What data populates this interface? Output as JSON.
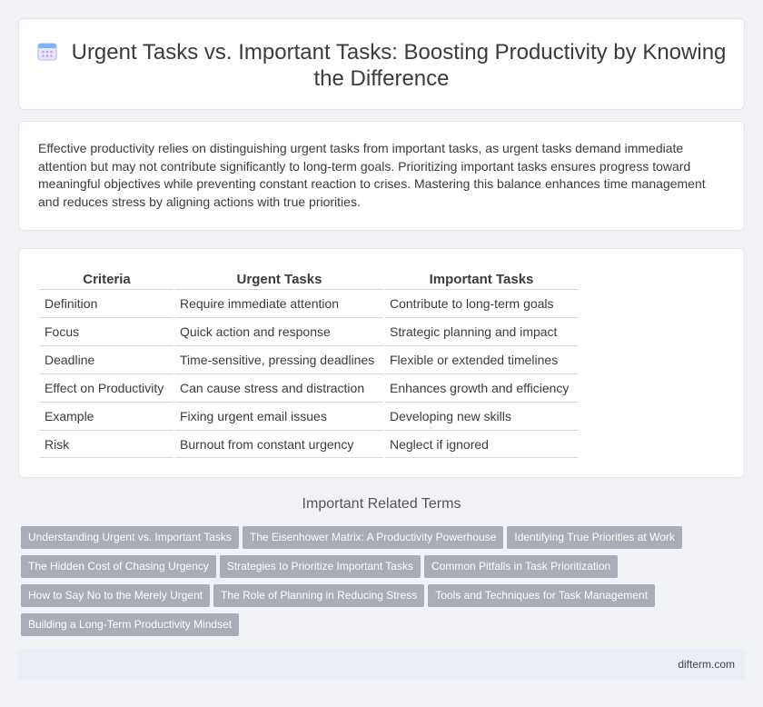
{
  "header": {
    "icon": "calendar-icon",
    "title": "Urgent Tasks vs. Important Tasks: Boosting Productivity by Knowing the Difference"
  },
  "intro": {
    "text": "Effective productivity relies on distinguishing urgent tasks from important tasks, as urgent tasks demand immediate attention but may not contribute significantly to long-term goals. Prioritizing important tasks ensures progress toward meaningful objectives while preventing constant reaction to crises. Mastering this balance enhances time management and reduces stress by aligning actions with true priorities."
  },
  "table": {
    "headers": [
      "Criteria",
      "Urgent Tasks",
      "Important Tasks"
    ],
    "rows": [
      [
        "Definition",
        "Require immediate attention",
        "Contribute to long-term goals"
      ],
      [
        "Focus",
        "Quick action and response",
        "Strategic planning and impact"
      ],
      [
        "Deadline",
        "Time-sensitive, pressing deadlines",
        "Flexible or extended timelines"
      ],
      [
        "Effect on Productivity",
        "Can cause stress and distraction",
        "Enhances growth and efficiency"
      ],
      [
        "Example",
        "Fixing urgent email issues",
        "Developing new skills"
      ],
      [
        "Risk",
        "Burnout from constant urgency",
        "Neglect if ignored"
      ]
    ]
  },
  "related": {
    "title": "Important Related Terms",
    "tags": [
      "Understanding Urgent vs. Important Tasks",
      "The Eisenhower Matrix: A Productivity Powerhouse",
      "Identifying True Priorities at Work",
      "The Hidden Cost of Chasing Urgency",
      "Strategies to Prioritize Important Tasks",
      "Common Pitfalls in Task Prioritization",
      "How to Say No to the Merely Urgent",
      "The Role of Planning in Reducing Stress",
      "Tools and Techniques for Task Management",
      "Building a Long-Term Productivity Mindset"
    ]
  },
  "footer": {
    "site": "difterm.com"
  },
  "colors": {
    "tag_bg": "#a9adb7",
    "footer_bg": "#e8edf6",
    "page_bg": "#f1f2f6"
  }
}
